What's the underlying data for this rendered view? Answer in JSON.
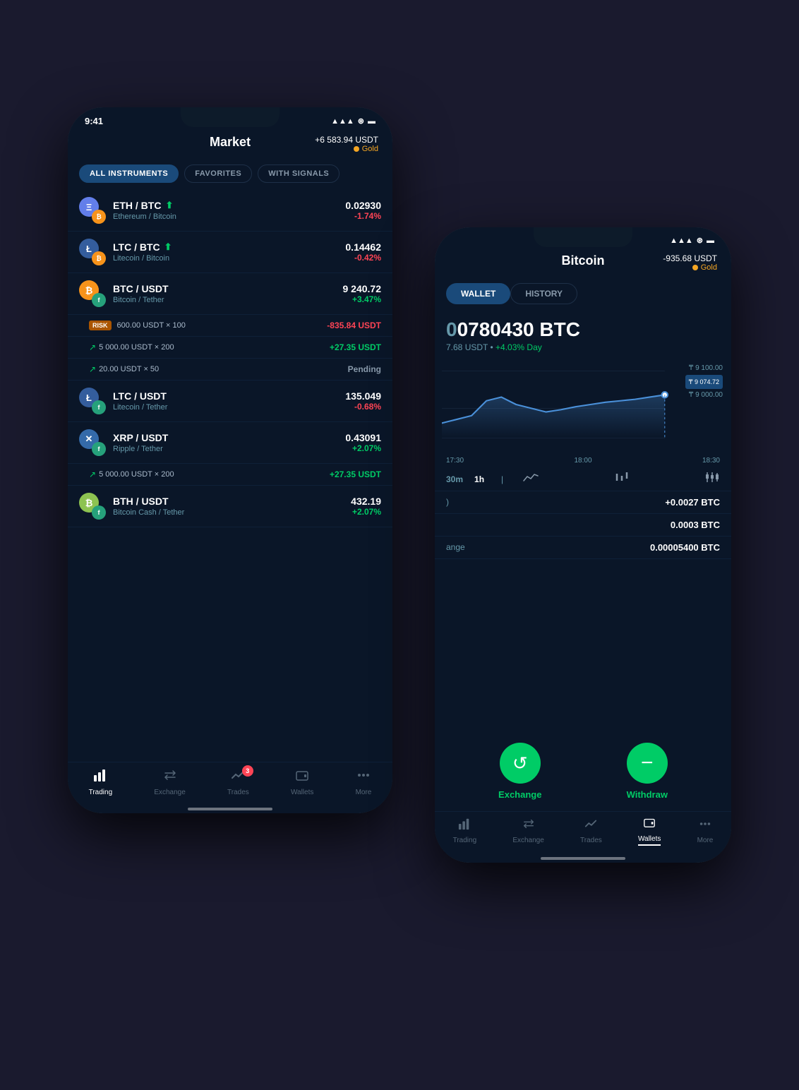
{
  "left_phone": {
    "status": {
      "time": "9:41",
      "signal": "▲▲▲",
      "wifi": "wifi",
      "battery": "battery"
    },
    "header": {
      "title": "Market",
      "balance": "+6 583.94 USDT",
      "tier": "Gold"
    },
    "filter_tabs": [
      {
        "label": "ALL INSTRUMENTS",
        "active": true
      },
      {
        "label": "FAVORITES",
        "active": false
      },
      {
        "label": "WITH SIGNALS",
        "active": false
      }
    ],
    "market_items": [
      {
        "pair": "ETH / BTC",
        "name": "Ethereum / Bitcoin",
        "price": "0.02930",
        "change": "-1.74%",
        "change_type": "negative",
        "has_signal": true,
        "primary_color": "#627eea",
        "secondary_color": "#f7931a",
        "primary_symbol": "Ξ",
        "secondary_symbol": "₿"
      },
      {
        "pair": "LTC / BTC",
        "name": "Litecoin / Bitcoin",
        "price": "0.14462",
        "change": "-0.42%",
        "change_type": "negative",
        "has_signal": true,
        "primary_color": "#345d9d",
        "secondary_color": "#f7931a",
        "primary_symbol": "Ł",
        "secondary_symbol": "₿"
      },
      {
        "pair": "BTC / USDT",
        "name": "Bitcoin / Tether",
        "price": "9 240.72",
        "change": "+3.47%",
        "change_type": "positive",
        "has_signal": false,
        "primary_color": "#f7931a",
        "secondary_color": "#26a17b",
        "primary_symbol": "₿",
        "secondary_symbol": "$"
      }
    ],
    "trade_rows": [
      {
        "type": "risk",
        "amount": "600.00 USDT × 100",
        "value": "-835.84 USDT",
        "value_type": "negative"
      },
      {
        "type": "arrow",
        "amount": "5 000.00 USDT × 200",
        "value": "+27.35 USDT",
        "value_type": "positive"
      },
      {
        "type": "arrow",
        "amount": "20.00 USDT × 50",
        "value": "Pending",
        "value_type": "pending"
      }
    ],
    "market_items_2": [
      {
        "pair": "LTC / USDT",
        "name": "Litecoin / Tether",
        "price": "135.049",
        "change": "-0.68%",
        "change_type": "negative",
        "primary_color": "#345d9d",
        "secondary_color": "#26a17b",
        "primary_symbol": "Ł",
        "secondary_symbol": "$"
      },
      {
        "pair": "XRP / USDT",
        "name": "Ripple / Tether",
        "price": "0.43091",
        "change": "+2.07%",
        "change_type": "positive",
        "primary_color": "#346aa9",
        "secondary_color": "#26a17b",
        "primary_symbol": "✕",
        "secondary_symbol": "$"
      }
    ],
    "trade_rows_2": [
      {
        "type": "arrow",
        "amount": "5 000.00 USDT × 200",
        "value": "+27.35 USDT",
        "value_type": "positive"
      }
    ],
    "market_items_3": [
      {
        "pair": "BTH / USDT",
        "name": "Bitcoin Cash / Tether",
        "price": "432.19",
        "change": "+2.07%",
        "change_type": "positive",
        "primary_color": "#8dc351",
        "secondary_color": "#26a17b",
        "primary_symbol": "₿",
        "secondary_symbol": "$"
      }
    ],
    "nav": {
      "items": [
        {
          "icon": "📊",
          "label": "Trading",
          "active": true,
          "badge": null
        },
        {
          "icon": "↔",
          "label": "Exchange",
          "active": false,
          "badge": null
        },
        {
          "icon": "📈",
          "label": "Trades",
          "active": false,
          "badge": "3"
        },
        {
          "icon": "▦",
          "label": "Wallets",
          "active": false,
          "badge": null
        },
        {
          "icon": "⋯",
          "label": "More",
          "active": false,
          "badge": null
        }
      ]
    }
  },
  "right_phone": {
    "status": {
      "time": "",
      "signal": "▲▲▲",
      "wifi": "wifi",
      "battery": "battery"
    },
    "header": {
      "title": "Bitcoin",
      "balance": "-935.68 USDT",
      "tier": "Gold"
    },
    "wallet_tabs": [
      {
        "label": "WALLET",
        "active": true
      },
      {
        "label": "HISTORY",
        "active": false
      }
    ],
    "btc_amount": "0780430 BTC",
    "btc_prefix": "0",
    "btc_usd": "7.68 USDT",
    "btc_change": "+4.03% Day",
    "chart": {
      "price_high": "₸ 9 100.00",
      "price_current": "₸ 9 074.72",
      "price_low": "₸ 9 000.00",
      "times": [
        "17:30",
        "18:00",
        "18:30"
      ]
    },
    "time_selectors": [
      "30m",
      "1h"
    ],
    "chart_types": [
      "line",
      "bar",
      "candle"
    ],
    "stats": [
      {
        "label": ")",
        "value": "+0.0027 BTC"
      },
      {
        "label": "",
        "value": "0.0003 BTC"
      },
      {
        "label": "ange",
        "value": "0.00005400 BTC"
      }
    ],
    "actions": [
      {
        "label": "Exchange",
        "icon": "↺",
        "type": "exchange"
      },
      {
        "label": "Withdraw",
        "icon": "−",
        "type": "withdraw"
      }
    ],
    "nav": {
      "items": [
        {
          "icon": "📊",
          "label": "Trading",
          "active": false
        },
        {
          "icon": "↔",
          "label": "Exchange",
          "active": false
        },
        {
          "icon": "📈",
          "label": "Trades",
          "active": false
        },
        {
          "icon": "▦",
          "label": "Wallets",
          "active": true
        },
        {
          "icon": "⋯",
          "label": "More",
          "active": false
        }
      ]
    }
  }
}
